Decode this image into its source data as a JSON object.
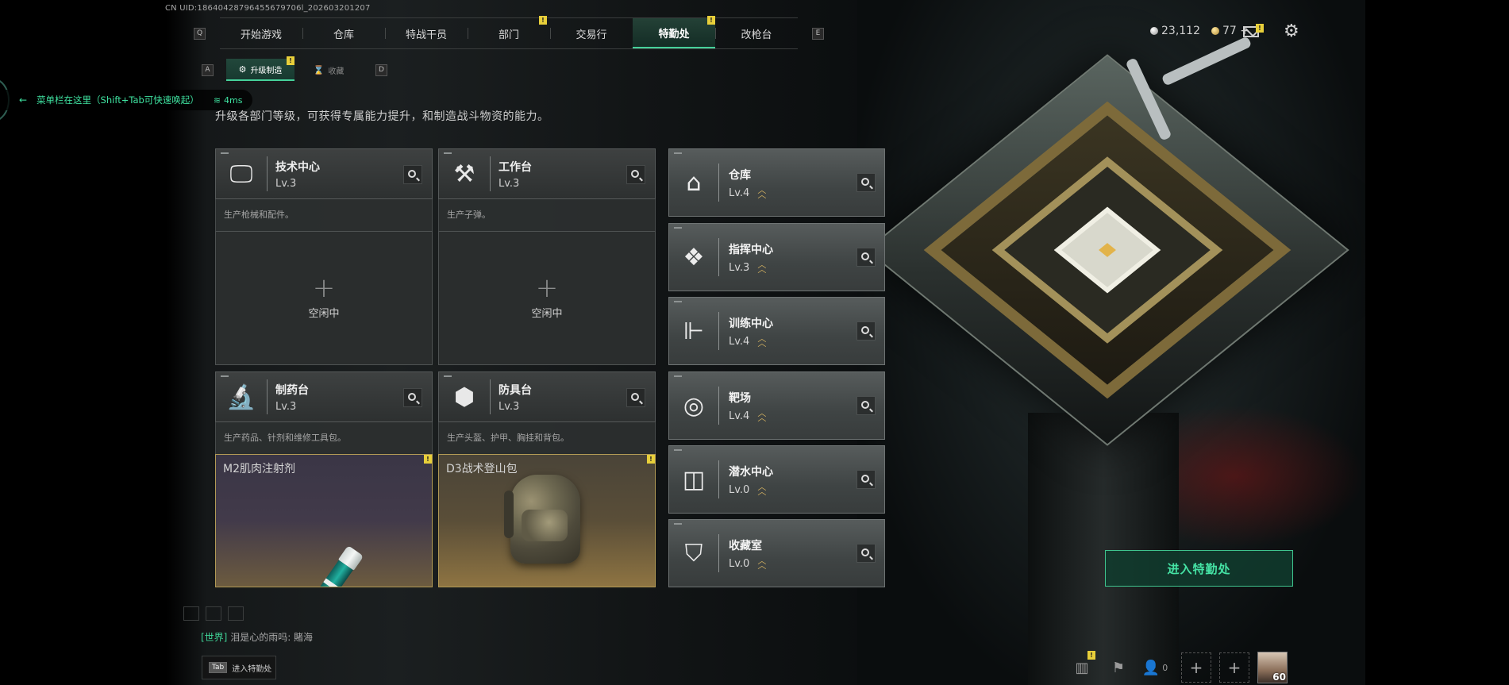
{
  "uid": "CN UID:18640428796455679706l_202603201207",
  "top_nav": {
    "left_key": "Q",
    "right_key": "E",
    "tabs": [
      {
        "label": "开始游戏",
        "badge": ""
      },
      {
        "label": "仓库",
        "badge": ""
      },
      {
        "label": "特战干员",
        "badge": ""
      },
      {
        "label": "部门",
        "badge": "!"
      },
      {
        "label": "交易行",
        "badge": ""
      },
      {
        "label": "特勤处",
        "badge": "!",
        "active": true
      },
      {
        "label": "改枪台",
        "badge": ""
      }
    ]
  },
  "sub_nav": {
    "left_key": "A",
    "right_key": "D",
    "tabs": [
      {
        "label": "升级制造",
        "active": true,
        "badge": "!"
      },
      {
        "label": "收藏",
        "active": false
      }
    ]
  },
  "currency": {
    "silver": "23,112",
    "gold": "77 +",
    "mail_badge": "!"
  },
  "menu_hint": {
    "text": "菜单栏在这里（Shift+Tab可快速唤起）",
    "ping": "4ms"
  },
  "description": "升级各部门等级，可获得专属能力提升，和制造战斗物资的能力。",
  "workshops": [
    {
      "name": "技术中心",
      "level": "Lv.3",
      "desc": "生产枪械和配件。",
      "icon": "monitor-icon",
      "slot": {
        "type": "idle",
        "label": "空闲中"
      }
    },
    {
      "name": "工作台",
      "level": "Lv.3",
      "desc": "生产子弹。",
      "icon": "hammer-wrench-icon",
      "slot": {
        "type": "idle",
        "label": "空闲中"
      }
    },
    {
      "name": "制药台",
      "level": "Lv.3",
      "desc": "生产药品、针剂和维修工具包。",
      "icon": "microscope-icon",
      "slot": {
        "type": "craft",
        "label": "M2肌肉注射剂",
        "badge": "!"
      }
    },
    {
      "name": "防具台",
      "level": "Lv.3",
      "desc": "生产头盔、护甲、胸挂和背包。",
      "icon": "cubes-icon",
      "slot": {
        "type": "craft",
        "label": "D3战术登山包",
        "badge": "!"
      }
    }
  ],
  "facilities": [
    {
      "name": "仓库",
      "level": "Lv.4",
      "icon": "warehouse-icon"
    },
    {
      "name": "指挥中心",
      "level": "Lv.3",
      "icon": "command-icon"
    },
    {
      "name": "训练中心",
      "level": "Lv.4",
      "icon": "dumbbell-icon"
    },
    {
      "name": "靶场",
      "level": "Lv.4",
      "icon": "target-icon"
    },
    {
      "name": "潜水中心",
      "level": "Lv.0",
      "icon": "diving-mask-icon"
    },
    {
      "name": "收藏室",
      "level": "Lv.0",
      "icon": "trophy-case-icon"
    }
  ],
  "enter_button": "进入特勤处",
  "chat": {
    "channel": "[世界]",
    "text": "泪是心的雨吗: 賭海"
  },
  "tab_hint": {
    "key": "Tab",
    "label": "进入特勤处"
  },
  "bottom_bar": {
    "people_count": "0",
    "avatar_level": "60",
    "stats_badge": "!"
  }
}
